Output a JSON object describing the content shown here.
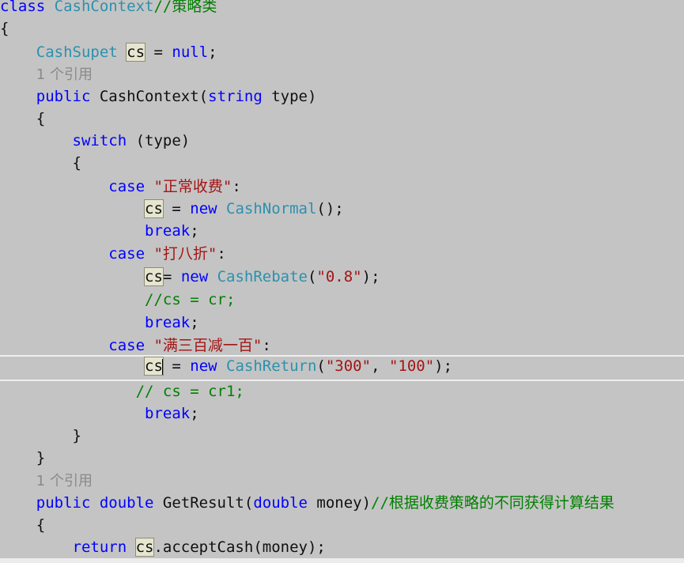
{
  "editor": {
    "lines": [
      [
        {
          "t": "class ",
          "c": "kw"
        },
        {
          "t": "CashContext",
          "c": "ty"
        },
        {
          "t": "//策略类",
          "c": "cmt"
        }
      ],
      [
        {
          "t": "{",
          "c": "pun"
        }
      ],
      [
        {
          "t": "    ",
          "c": "pun"
        },
        {
          "t": "CashSupet",
          "c": "ty"
        },
        {
          "t": " ",
          "c": "pun"
        },
        {
          "t": "cs",
          "c": "pun",
          "hl": true
        },
        {
          "t": " = ",
          "c": "pun"
        },
        {
          "t": "null",
          "c": "kw"
        },
        {
          "t": ";",
          "c": "pun"
        }
      ],
      [
        {
          "t": "    ",
          "c": "pun"
        },
        {
          "t": "1 个引用",
          "c": "ref"
        }
      ],
      [
        {
          "t": "    ",
          "c": "pun"
        },
        {
          "t": "public ",
          "c": "kw"
        },
        {
          "t": "CashContext(",
          "c": "pun"
        },
        {
          "t": "string",
          "c": "kw"
        },
        {
          "t": " type)",
          "c": "pun"
        }
      ],
      [
        {
          "t": "    {",
          "c": "pun"
        }
      ],
      [
        {
          "t": "        ",
          "c": "pun"
        },
        {
          "t": "switch",
          "c": "kw"
        },
        {
          "t": " (type)",
          "c": "pun"
        }
      ],
      [
        {
          "t": "        {",
          "c": "pun"
        }
      ],
      [
        {
          "t": "            ",
          "c": "pun"
        },
        {
          "t": "case ",
          "c": "kw"
        },
        {
          "t": "\"正常收费\"",
          "c": "str"
        },
        {
          "t": ":",
          "c": "pun"
        }
      ],
      [
        {
          "t": "                ",
          "c": "pun"
        },
        {
          "t": "cs",
          "c": "pun",
          "hl": true
        },
        {
          "t": " = ",
          "c": "pun"
        },
        {
          "t": "new ",
          "c": "kw"
        },
        {
          "t": "CashNormal",
          "c": "ty"
        },
        {
          "t": "();",
          "c": "pun"
        }
      ],
      [
        {
          "t": "                ",
          "c": "pun"
        },
        {
          "t": "break",
          "c": "kw"
        },
        {
          "t": ";",
          "c": "pun"
        }
      ],
      [
        {
          "t": "            ",
          "c": "pun"
        },
        {
          "t": "case ",
          "c": "kw"
        },
        {
          "t": "\"打八折\"",
          "c": "str"
        },
        {
          "t": ":",
          "c": "pun"
        }
      ],
      [
        {
          "t": "                ",
          "c": "pun"
        },
        {
          "t": "cs",
          "c": "pun",
          "hl": true
        },
        {
          "t": "= ",
          "c": "pun"
        },
        {
          "t": "new ",
          "c": "kw"
        },
        {
          "t": "CashRebate",
          "c": "ty"
        },
        {
          "t": "(",
          "c": "pun"
        },
        {
          "t": "\"0.8\"",
          "c": "str"
        },
        {
          "t": ");",
          "c": "pun"
        }
      ],
      [
        {
          "t": "                ",
          "c": "pun"
        },
        {
          "t": "//cs = cr;",
          "c": "cmt"
        }
      ],
      [
        {
          "t": "                ",
          "c": "pun"
        },
        {
          "t": "break",
          "c": "kw"
        },
        {
          "t": ";",
          "c": "pun"
        }
      ],
      [
        {
          "t": "            ",
          "c": "pun"
        },
        {
          "t": "case ",
          "c": "kw"
        },
        {
          "t": "\"满三百减一百\"",
          "c": "str"
        },
        {
          "t": ":",
          "c": "pun"
        }
      ],
      [
        {
          "t": "                ",
          "c": "pun"
        },
        {
          "t": "cs",
          "c": "pun",
          "hl": true,
          "cursor": true
        },
        {
          "t": " = ",
          "c": "pun"
        },
        {
          "t": "new ",
          "c": "kw"
        },
        {
          "t": "CashReturn",
          "c": "ty"
        },
        {
          "t": "(",
          "c": "pun"
        },
        {
          "t": "\"300\"",
          "c": "str"
        },
        {
          "t": ", ",
          "c": "pun"
        },
        {
          "t": "\"100\"",
          "c": "str"
        },
        {
          "t": ");",
          "c": "pun"
        }
      ],
      [
        {
          "t": "               ",
          "c": "pun"
        },
        {
          "t": "// cs = cr1;",
          "c": "cmt"
        }
      ],
      [
        {
          "t": "                ",
          "c": "pun"
        },
        {
          "t": "break",
          "c": "kw"
        },
        {
          "t": ";",
          "c": "pun"
        }
      ],
      [
        {
          "t": "        }",
          "c": "pun"
        }
      ],
      [
        {
          "t": "    }",
          "c": "pun"
        }
      ],
      [
        {
          "t": "    ",
          "c": "pun"
        },
        {
          "t": "1 个引用",
          "c": "ref"
        }
      ],
      [
        {
          "t": "    ",
          "c": "pun"
        },
        {
          "t": "public ",
          "c": "kw"
        },
        {
          "t": "double ",
          "c": "kw"
        },
        {
          "t": "GetResult(",
          "c": "pun"
        },
        {
          "t": "double ",
          "c": "kw"
        },
        {
          "t": "money)",
          "c": "pun"
        },
        {
          "t": "//根据收费策略的不同获得计算结果",
          "c": "cmt"
        }
      ],
      [
        {
          "t": "    {",
          "c": "pun"
        }
      ],
      [
        {
          "t": "        ",
          "c": "pun"
        },
        {
          "t": "return ",
          "c": "kw"
        },
        {
          "t": "cs",
          "c": "pun",
          "hl": true
        },
        {
          "t": ".acceptCash(money);",
          "c": "pun"
        }
      ]
    ]
  },
  "colors": {
    "background": "#c4c4c4",
    "keyword": "#0000ff",
    "type": "#2b91af",
    "string": "#a31515",
    "comment": "#008000",
    "codelens": "#8a8a8a",
    "reference_highlight": "#e6e6d0"
  }
}
